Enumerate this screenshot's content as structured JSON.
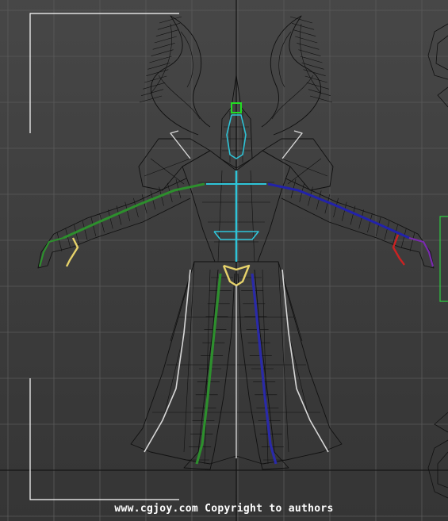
{
  "viewport": {
    "background": "#404040",
    "grid_color": "#5a5a5a",
    "axis_color": "#111111",
    "bracket_color": "#ffffff",
    "selection_bracket_color": "#2ecc40"
  },
  "model": {
    "wire_color": "#101010",
    "bone_colors": {
      "spine": "#2ec4d8",
      "left_arm": "#2d8f2d",
      "right_arm": "#2222aa",
      "left_leg": "#2d8f2d",
      "right_leg": "#2a2aa8",
      "cloth_bones": "#d8d8d8",
      "left_hand": "#e6d26a",
      "right_hand": "#cc2222",
      "pelvis": "#e6d26a",
      "head_marker": "#22dd22"
    }
  },
  "watermark": {
    "text": "www.cgjoy.com Copyright to authors"
  }
}
